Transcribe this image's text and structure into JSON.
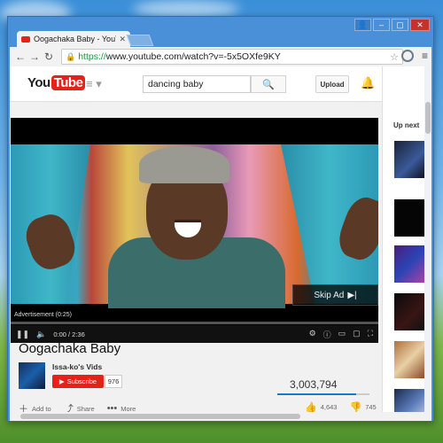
{
  "browser": {
    "tab_title": "Oogachaka Baby - YouTub",
    "url_scheme": "https://",
    "url_rest": "www.youtube.com/watch?v=-5x5OXfe9KY"
  },
  "header": {
    "logo_you": "You",
    "logo_tube": "Tube",
    "search_value": "dancing baby",
    "upload_label": "Upload"
  },
  "player": {
    "skip_label": "Skip Ad",
    "ad_label": "Advertisement (0:25)",
    "time": "0:00 / 2:36",
    "progress": 0.0
  },
  "video": {
    "title": "Oogachaka Baby",
    "channel": "Issa-ko's Vids",
    "subscribe_label": "Subscribe",
    "subscriber_count": "976",
    "views": "3,003,794",
    "likes": "4,643",
    "dislikes": "745",
    "like_ratio": 0.86,
    "add_to_label": "Add to",
    "share_label": "Share",
    "more_label": "More"
  },
  "sidebar": {
    "up_next_label": "Up next"
  },
  "colors": {
    "accent": "#e62117",
    "progress": "#e8b520",
    "like_bar": "#167ac6"
  }
}
